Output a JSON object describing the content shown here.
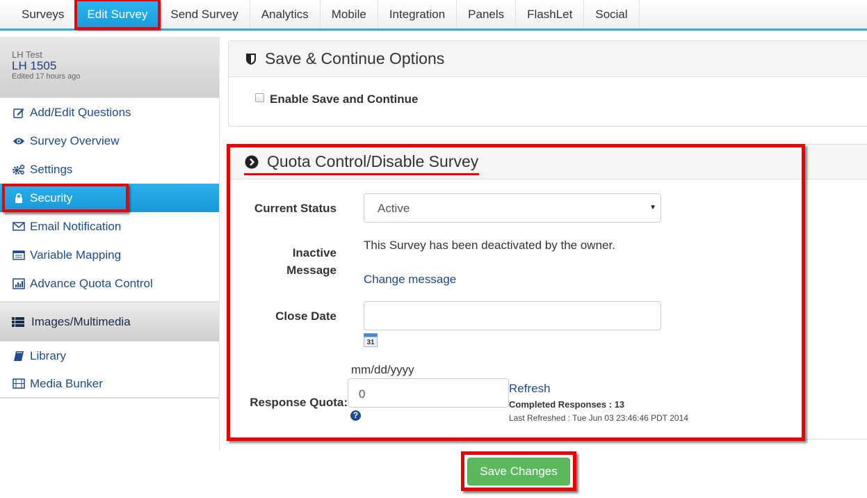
{
  "topnav": {
    "tabs": [
      {
        "label": "Surveys",
        "active": false
      },
      {
        "label": "Edit Survey",
        "active": true
      },
      {
        "label": "Send Survey",
        "active": false
      },
      {
        "label": "Analytics",
        "active": false
      },
      {
        "label": "Mobile",
        "active": false
      },
      {
        "label": "Integration",
        "active": false
      },
      {
        "label": "Panels",
        "active": false
      },
      {
        "label": "FlashLet",
        "active": false
      },
      {
        "label": "Social",
        "active": false
      }
    ]
  },
  "sidebar": {
    "survey": {
      "folder": "LH Test",
      "name": "LH 1505",
      "edited": "Edited 17 hours ago"
    },
    "items": [
      {
        "label": "Add/Edit Questions",
        "icon": "edit-icon"
      },
      {
        "label": "Survey Overview",
        "icon": "eye-icon"
      },
      {
        "label": "Settings",
        "icon": "gears-icon"
      },
      {
        "label": "Security",
        "icon": "lock-icon",
        "active": true
      },
      {
        "label": "Email Notification",
        "icon": "envelope-icon"
      },
      {
        "label": "Variable Mapping",
        "icon": "list-icon"
      },
      {
        "label": "Advance Quota Control",
        "icon": "bar-chart-icon"
      }
    ],
    "section": {
      "label": "Images/Multimedia",
      "icon": "th-list-icon"
    },
    "section_items": [
      {
        "label": "Library",
        "icon": "book-icon"
      },
      {
        "label": "Media Bunker",
        "icon": "film-icon"
      }
    ]
  },
  "save_continue": {
    "title": "Save & Continue Options",
    "checkbox_label": "Enable Save and Continue",
    "checked": false
  },
  "quota": {
    "title": "Quota Control/Disable Survey",
    "current_status_label": "Current Status",
    "current_status_value": "Active",
    "inactive_label_line1": "Inactive",
    "inactive_label_line2": "Message",
    "inactive_message": "This Survey has been deactivated by the owner.",
    "change_message_link": "Change message",
    "close_date_label": "Close Date",
    "close_date_value": "",
    "close_date_format": "mm/dd/yyyy",
    "calendar_day": "31",
    "response_quota_label": "Response Quota:",
    "response_quota_value": "0",
    "refresh_link": "Refresh",
    "completed_responses": "Completed Responses : 13",
    "last_refreshed": "Last Refreshed : Tue Jun 03 23:46:46 PDT 2014"
  },
  "footer": {
    "save_button": "Save Changes"
  },
  "colors": {
    "accent_blue": "#1a9bdc",
    "link_blue": "#1f4a8c",
    "save_green": "#5cb85c",
    "highlight_red": "#ee0000"
  }
}
